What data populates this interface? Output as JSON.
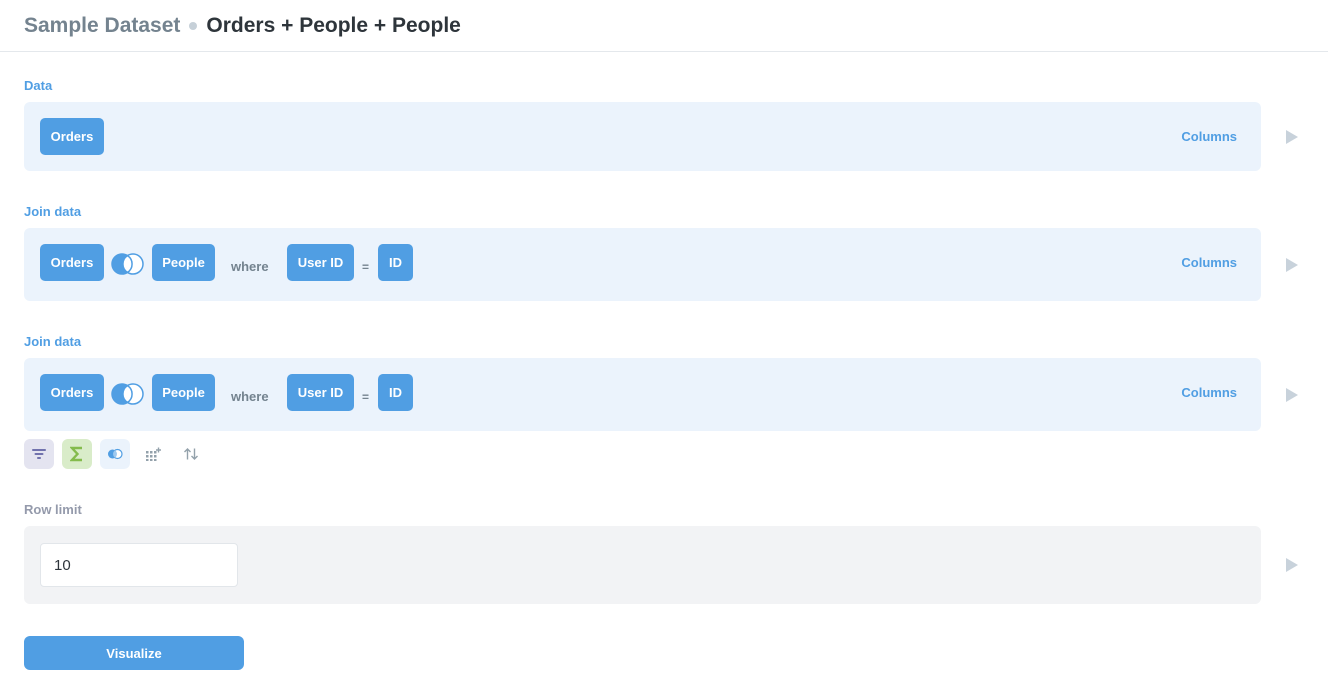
{
  "header": {
    "database": "Sample Dataset",
    "title": "Orders + People + People"
  },
  "data_step": {
    "label": "Data",
    "table": "Orders",
    "columns_label": "Columns"
  },
  "joins": [
    {
      "label": "Join data",
      "left_table": "Orders",
      "join_type_icon": "left-join-icon",
      "right_table": "People",
      "where_label": "where",
      "left_field": "User ID",
      "operator": "=",
      "right_field": "ID",
      "columns_label": "Columns"
    },
    {
      "label": "Join data",
      "left_table": "Orders",
      "join_type_icon": "left-join-icon",
      "right_table": "People",
      "where_label": "where",
      "left_field": "User ID",
      "operator": "=",
      "right_field": "ID",
      "columns_label": "Columns"
    }
  ],
  "actions": [
    {
      "name": "filter-icon",
      "color": "#7172ad",
      "bg": "#e4e4f0"
    },
    {
      "name": "sum-icon",
      "color": "#84bb4c",
      "bg": "#d9ecc9"
    },
    {
      "name": "join-icon",
      "color": "#509ee3",
      "bg": "#ebf3fc"
    },
    {
      "name": "custom-column-icon",
      "color": "#93a1ab"
    },
    {
      "name": "sort-icon",
      "color": "#93a1ab"
    }
  ],
  "row_limit": {
    "label": "Row limit",
    "value": "10"
  },
  "visualize_label": "Visualize",
  "colors": {
    "brand": "#509ee3",
    "step_bg": "#ebf3fc",
    "limit_bg": "#f2f3f5",
    "muted_text": "#74838f",
    "title_text": "#2e353b"
  }
}
